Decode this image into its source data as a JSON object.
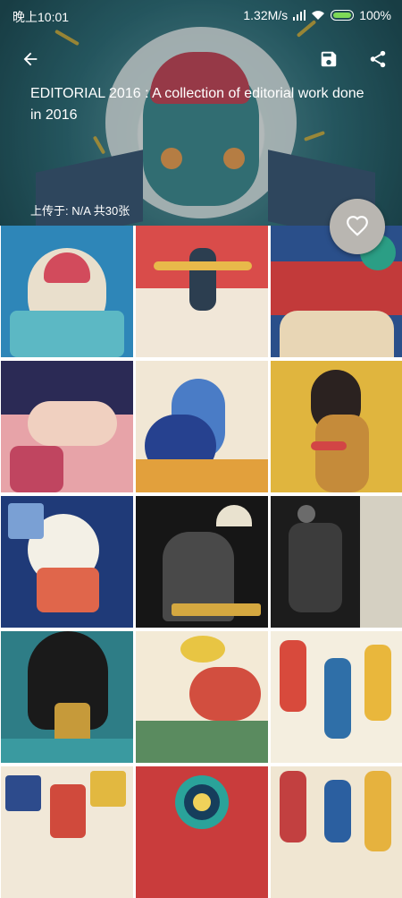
{
  "status_bar": {
    "time": "晚上10:01",
    "network_speed": "1.32M/s",
    "battery": "100%"
  },
  "header": {
    "title": "EDITORIAL 2016 : A collection of editorial work done in 2016",
    "meta": "上传于: N/A  共30张"
  },
  "icons": {
    "back": "back-arrow-icon",
    "save": "save-icon",
    "share": "share-icon",
    "favorite": "heart-icon"
  },
  "thumbnails": [
    {
      "bg": "#2e86b8",
      "a": "#e9dfcc",
      "b": "#d24b5c",
      "c": "#5cb8c4"
    },
    {
      "bg": "#d94c4a",
      "a": "#f1e7d8",
      "b": "#2c3e50",
      "c": "#e8b94a"
    },
    {
      "bg": "#2a4f8a",
      "a": "#c23a3a",
      "b": "#e8d6b5",
      "c": "#2b9e85"
    },
    {
      "bg": "#e7a3a8",
      "a": "#2b2a55",
      "b": "#f0d0c0",
      "c": "#c04560"
    },
    {
      "bg": "#f1e7d5",
      "a": "#4a7cc6",
      "b": "#26418f",
      "c": "#e2a03c"
    },
    {
      "bg": "#e0b53e",
      "a": "#2b2220",
      "b": "#c58b3a",
      "c": "#d24545"
    },
    {
      "bg": "#1f3a78",
      "a": "#f3f0e6",
      "b": "#e0664b",
      "c": "#7aa0d4"
    },
    {
      "bg": "#161616",
      "a": "#e9e2cf",
      "b": "#494949",
      "c": "#d5a840"
    },
    {
      "bg": "#1c1c1c",
      "a": "#3c3c3c",
      "b": "#d5d0c2",
      "c": "#6b6b6b"
    },
    {
      "bg": "#2e7d86",
      "a": "#1a1a1a",
      "b": "#c69a3a",
      "c": "#3a9aa0"
    },
    {
      "bg": "#f3ead6",
      "a": "#e8c543",
      "b": "#d24e3f",
      "c": "#5a8b5f"
    },
    {
      "bg": "#f4eedf",
      "a": "#d84a3c",
      "b": "#2f6fa8",
      "c": "#e9b73c"
    },
    {
      "bg": "#f1e8d8",
      "a": "#2d4b8c",
      "b": "#d04a3c",
      "c": "#e2b840"
    },
    {
      "bg": "#c93c3c",
      "a": "#2aa39a",
      "b": "#163e5c",
      "c": "#f0d25a"
    },
    {
      "bg": "#f0e6d2",
      "a": "#c24040",
      "b": "#2b5fa0",
      "c": "#e6b23e"
    }
  ]
}
